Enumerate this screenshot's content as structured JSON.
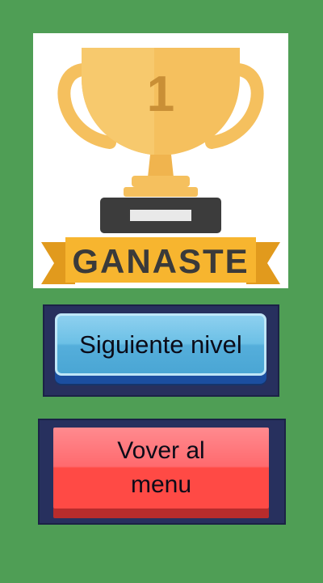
{
  "winner_card": {
    "rank_number": "1",
    "banner_text": "GANASTE"
  },
  "buttons": {
    "next_level_label": "Siguiente nivel",
    "back_to_menu_label": "Vover al menu"
  },
  "colors": {
    "background": "#4f9e55",
    "trophy": "#f5c05e",
    "banner": "#f7b52f",
    "next_button": "#5bb6e0",
    "menu_button": "#ff5a55",
    "button_frame": "#27305e"
  }
}
